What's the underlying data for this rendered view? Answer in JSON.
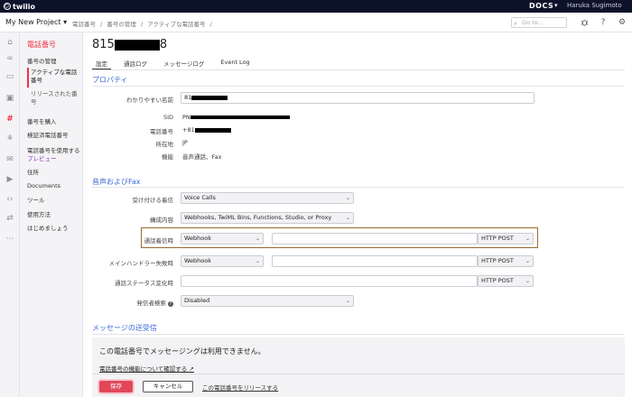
{
  "topbar": {
    "logo_text": "twilio",
    "docs_label": "DOCS",
    "docs_caret": "▾",
    "user_name": "Haruka Sugimoto"
  },
  "header": {
    "project": "My New Project",
    "project_caret": "▾",
    "breadcrumb": [
      "電話番号",
      "/",
      "番号の管理",
      "/",
      "アクティブな電話番号",
      "/"
    ],
    "goto_placeholder": "Go to...",
    "icons": [
      "bug-icon",
      "help-icon",
      "gear-icon"
    ]
  },
  "rail": {
    "icons": [
      "home-icon",
      "link-icon",
      "chat-icon",
      "sim-icon",
      "hash-icon",
      "flow-icon",
      "message-icon",
      "video-icon",
      "code-icon",
      "shuffle-icon",
      "more-icon"
    ],
    "active": "hash-icon"
  },
  "sidebar": {
    "title": "電話番号",
    "items": {
      "manage": "番号の管理",
      "active_numbers": "アクティブな電話番号",
      "released_numbers": "リリースされた番号",
      "buy": "番号を購入",
      "verified": "検証済電話番号",
      "using": "電話番号を使用する",
      "preview": "プレビュー",
      "address": "住所",
      "documents": "Documents",
      "tools": "ツール",
      "usage": "使用方法",
      "getting_started": "はじめましょう"
    }
  },
  "page": {
    "title_prefix": "815",
    "title_suffix": "8",
    "tabs": [
      "設定",
      "通話ログ",
      "メッセージログ",
      "Event Log"
    ]
  },
  "properties": {
    "section_title": "プロパティ",
    "friendly_name_label": "わかりやすい名前",
    "friendly_name_value": "81",
    "sid_label": "SID",
    "sid_value": "PN",
    "phone_label": "電話番号",
    "phone_value": "+81",
    "location_label": "所在地",
    "location_value": "JP",
    "capability_label": "機能",
    "capability_value": "音声通話、Fax"
  },
  "voice": {
    "section_title": "音声およびFax",
    "accept_label": "受け付ける着信",
    "accept_value": "Voice Calls",
    "config_label": "構成内容",
    "config_value": "Webhooks, TwiML Bins, Functions, Studio, or Proxy",
    "call_label": "通話着信時",
    "call_type": "Webhook",
    "call_url": "",
    "call_method": "HTTP POST",
    "fallback_label": "メインハンドラー失敗時",
    "fallback_type": "Webhook",
    "fallback_url": "",
    "fallback_method": "HTTP POST",
    "status_label": "通話ステータス変化時",
    "status_url": "",
    "status_method": "HTTP POST",
    "callerid_label": "発信者検索",
    "callerid_value": "Disabled"
  },
  "messaging": {
    "section_title": "メッセージの送受信",
    "unavailable_text": "この電話番号でメッセージングは利用できません。",
    "learn_link": "電話番号の機能について確認する ↗"
  },
  "footer": {
    "save": "保存",
    "cancel": "キャンセル",
    "release": "この電話番号をリリースする"
  }
}
